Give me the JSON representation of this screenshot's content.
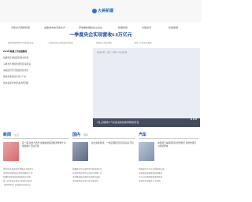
{
  "header": {
    "logo_text": "大美新疆"
  },
  "nav": {
    "items": [
      "乌鲁木齐国际机场",
      "这座城市的乌鲁木齐",
      "带你看新疆的好山好水",
      "新疆特色",
      "文旅资讯",
      "红色旅游"
    ]
  },
  "headline": "一季度央企实现营收6.8万亿元",
  "sublinks": [
    "国务院国资委举行新闻发布会",
    "一季度中央企业经济运行情况",
    "研发投入同比增长",
    "带动上下游协同发展"
  ],
  "list": {
    "items": [
      "2024年春播工作进展顺利",
      "新疆棉花种植面积稳中有增",
      "乌鲁木齐国际陆港区建设提速",
      "中欧班列开行数量持续增长",
      "旅游市场持续升温人气旺",
      "各地多措并举促进消费回暖"
    ]
  },
  "banner": {
    "crumb": "当前位置：首页 > 国际 > 热点新闻",
    "caption": "1月上旬我市人气旺盛 各地文旅市场持续升温"
  },
  "sections": {
    "left": {
      "title": "新闻",
      "subtitle": "生活",
      "feature": "第一届“新出乡游乐”新疆旅游集团旅游季暨乡村旅游推介活动开幕",
      "lines": [
        "2024年首批旅游专列抵达乌鲁木齐",
        "各地加快推进高标准农田建设工作",
        "新疆打造特色旅游线路吸引游客",
        "第一届“新出乡游乐”活动正式启动",
        "【新闻特写】各族群众欢度佳节"
      ]
    },
    "middle": {
      "title": "国内",
      "subtitle": "国际",
      "feature": "总台央视新闻：一季度国民经济实现良好开局",
      "lines": [
        "新疆维吾尔自治区举行新闻发布会",
        "自治区政府常务会议研究部署工作",
        "多地推进城市更新行动提升品质",
        "全国春季农业生产有序推进中"
      ]
    },
    "right": {
      "title": "汽车",
      "subtitle": "",
      "feature": "新能源汽车销量同比增长明显 消费市场活力持续释放",
      "lines": [
        "新能源汽车下乡活动陆续启动",
        "充电基础设施建设加快推进",
        "汽车以旧换新政策落地见效",
        "多款新车型集中上市亮相"
      ]
    }
  }
}
